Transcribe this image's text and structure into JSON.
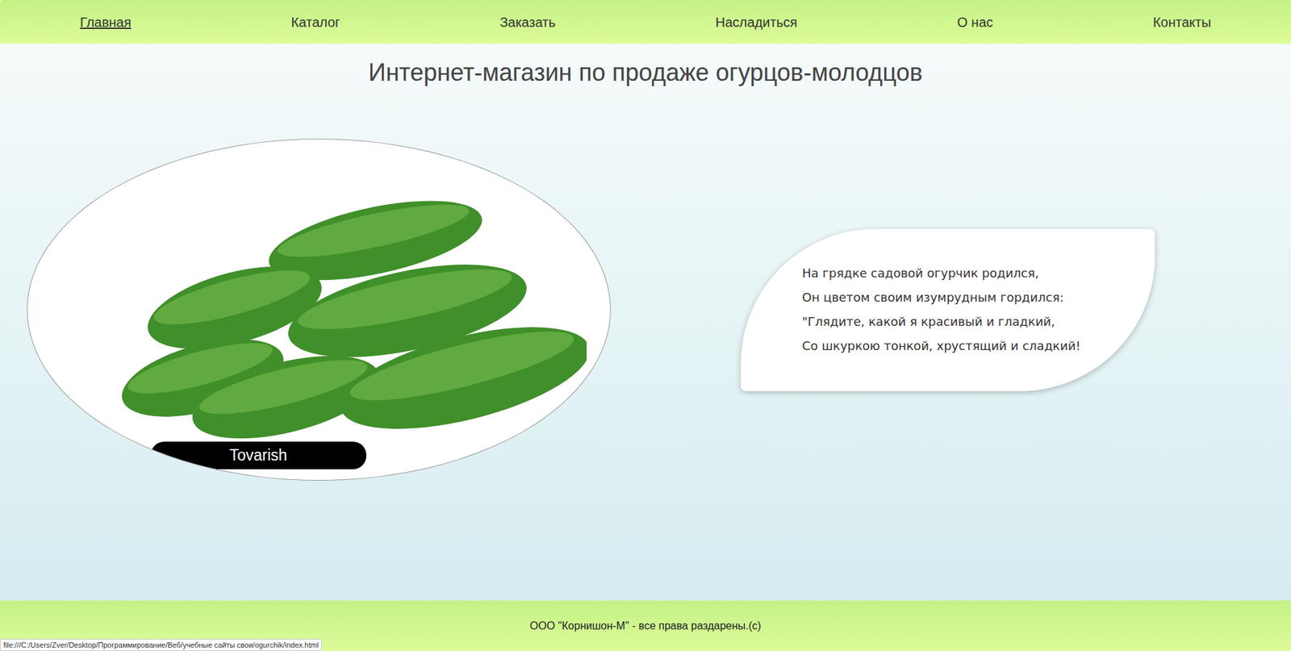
{
  "nav": {
    "items": [
      {
        "label": "Главная",
        "selected": true
      },
      {
        "label": "Каталог",
        "selected": false
      },
      {
        "label": "Заказать",
        "selected": false
      },
      {
        "label": "Насладиться",
        "selected": false
      },
      {
        "label": "О нас",
        "selected": false
      },
      {
        "label": "Контакты",
        "selected": false
      }
    ]
  },
  "heading": "Интернет-магазин по продаже огурцов-молодцов",
  "product": {
    "caption": "Tovarish"
  },
  "poem": {
    "lines": [
      "На грядке садовой огурчик родился,",
      "Он цветом своим изумрудным гордился:",
      "\"Глядите, какой я красивый и гладкий,",
      "Со шкуркою тонкой, хрустящий и сладкий!"
    ]
  },
  "footer": {
    "text": "ООО \"Корнишон-М\" - все права раздарены.(с)"
  },
  "status_bar": {
    "url": "file:///C:/Users/Zver/Desktop/Программирование/Веб/учебные сайты свои/ogurchik/index.html"
  }
}
